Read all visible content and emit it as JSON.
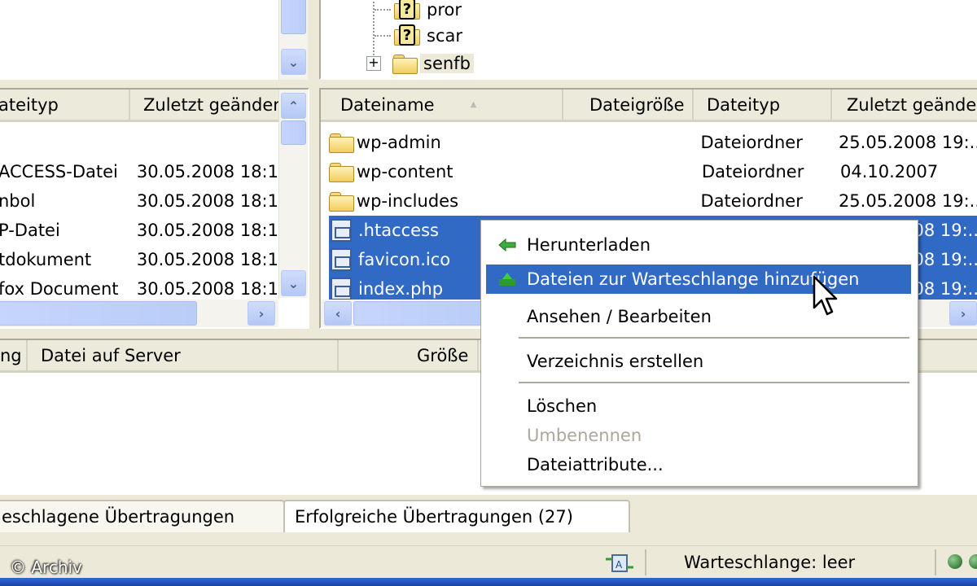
{
  "remote_tree": {
    "items": [
      {
        "label": "pror",
        "icon": "unknown-folder-icon"
      },
      {
        "label": "scar",
        "icon": "unknown-folder-icon"
      },
      {
        "label": "senfb",
        "icon": "folder-icon",
        "expander": "+"
      }
    ]
  },
  "local_list": {
    "columns": [
      "ateityp",
      "Zuletzt geänder"
    ],
    "rows": [
      {
        "type": "ACCESS-Datei",
        "modified": "30.05.2008 18:1"
      },
      {
        "type": "nbol",
        "modified": "30.05.2008 18:1"
      },
      {
        "type": "P-Datei",
        "modified": "30.05.2008 18:1"
      },
      {
        "type": "tdokument",
        "modified": "30.05.2008 18:1"
      },
      {
        "type": "fox Document",
        "modified": "30.05.2008 18:1"
      }
    ]
  },
  "remote_list": {
    "columns": [
      "Dateiname",
      "Dateigröße",
      "Dateityp",
      "Zuletzt geänder"
    ],
    "sort_indicator": "▲",
    "rows": [
      {
        "name": "wp-admin",
        "size": "",
        "type": "Dateiordner",
        "modified": "25.05.2008 19:..",
        "kind": "folder",
        "selected": false
      },
      {
        "name": "wp-content",
        "size": "",
        "type": "Dateiordner",
        "modified": "04.10.2007",
        "kind": "folder",
        "selected": false
      },
      {
        "name": "wp-includes",
        "size": "",
        "type": "Dateiordner",
        "modified": "25.05.2008 19:..",
        "kind": "folder",
        "selected": false
      },
      {
        "name": ".htaccess",
        "size": "",
        "type": "",
        "modified": "08 19:..",
        "kind": "file",
        "selected": true
      },
      {
        "name": "favicon.ico",
        "size": "",
        "type": "",
        "modified": "08 19:..",
        "kind": "file",
        "selected": true
      },
      {
        "name": "index.php",
        "size": "",
        "type": "",
        "modified": "08 19:..",
        "kind": "file",
        "selected": true
      }
    ]
  },
  "queue": {
    "columns": [
      "ng",
      "Datei auf Server",
      "Größe"
    ]
  },
  "context_menu": {
    "items": [
      {
        "label": "Herunterladen",
        "icon": "download-arrow-icon",
        "highlighted": false,
        "disabled": false
      },
      {
        "label": "Dateien zur Warteschlange hinzufügen",
        "icon": "add-to-queue-icon",
        "highlighted": true,
        "disabled": false
      },
      {
        "label": "Ansehen / Bearbeiten",
        "highlighted": false,
        "disabled": false
      },
      {
        "label": "Verzeichnis erstellen",
        "highlighted": false,
        "disabled": false
      },
      {
        "label": "Löschen",
        "highlighted": false,
        "disabled": false
      },
      {
        "label": "Umbenennen",
        "highlighted": false,
        "disabled": true
      },
      {
        "label": "Dateiattribute...",
        "highlighted": false,
        "disabled": false
      }
    ]
  },
  "tabs": [
    {
      "label": "eschlagene Übertragungen"
    },
    {
      "label": "Erfolgreiche Übertragungen (27)"
    }
  ],
  "status": {
    "queue_text": "Warteschlange: leer",
    "copyright": "© Archiv"
  },
  "colors": {
    "selection": "#316ac5",
    "chrome": "#ece9d8",
    "taskbar": "#2457c6"
  }
}
